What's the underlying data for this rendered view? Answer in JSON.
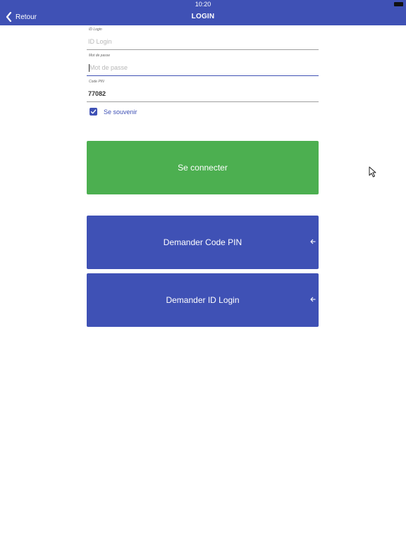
{
  "status_bar": {
    "time": "10:20"
  },
  "nav": {
    "back_label": "Retour",
    "title": "LOGIN"
  },
  "form": {
    "login_id": {
      "label": "ID Login",
      "placeholder": "ID Login",
      "value": ""
    },
    "password": {
      "label": "Mot de passe",
      "placeholder": "Mot de passe",
      "value": ""
    },
    "pin": {
      "label": "Code PIN",
      "value": "77082"
    },
    "remember": {
      "label": "Se souvenir",
      "checked": true
    }
  },
  "buttons": {
    "connect": "Se connecter",
    "request_pin": "Demander Code PIN",
    "request_login": "Demander ID Login"
  },
  "icons": {
    "back": "chevron-left-icon",
    "check": "check-icon",
    "arrow": "arrow-left-icon",
    "cursor": "mouse-pointer-icon"
  },
  "colors": {
    "primary": "#3f51b5",
    "success": "#4caf50"
  }
}
